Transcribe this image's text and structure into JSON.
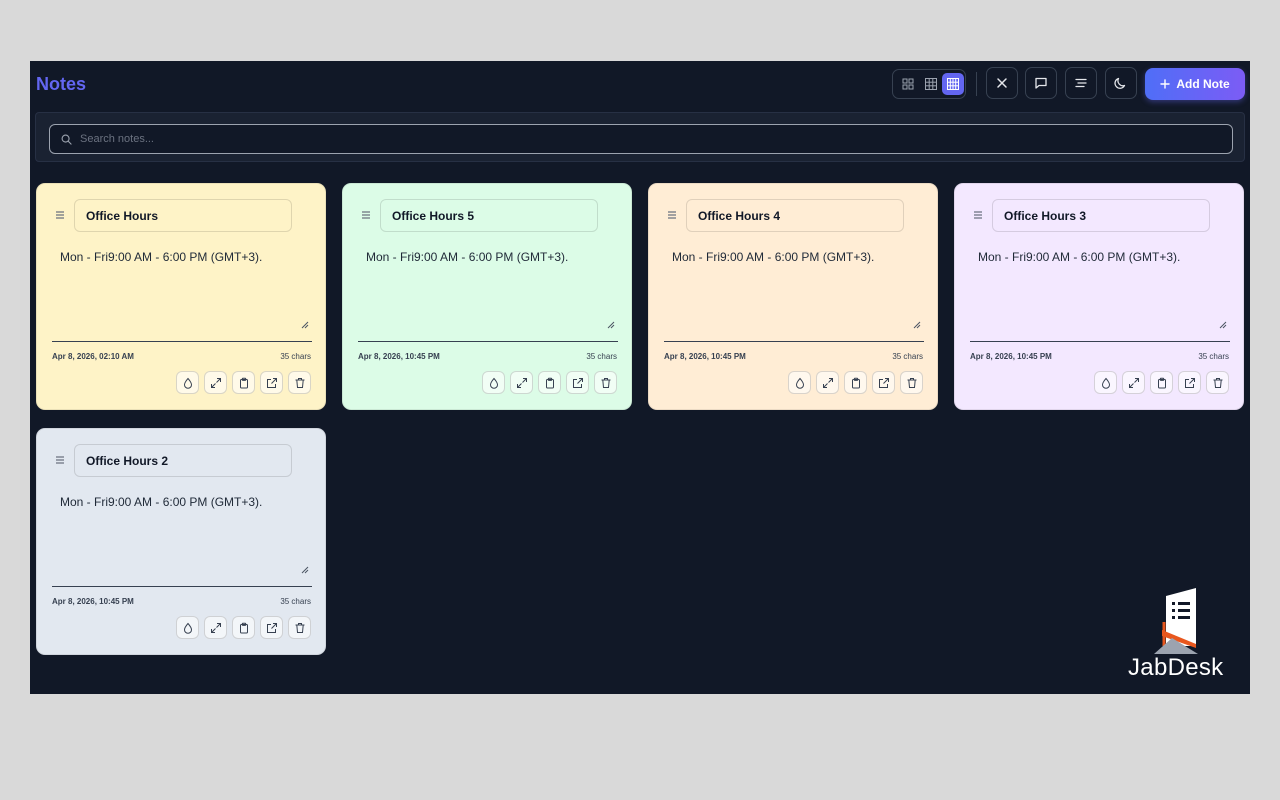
{
  "app": {
    "title": "Notes"
  },
  "toolbar": {
    "add_note_label": "Add Note",
    "view_modes": [
      "grid-2-icon",
      "grid-3-icon",
      "grid-4-icon"
    ],
    "active_view": "grid-4-icon"
  },
  "search": {
    "placeholder": "Search notes...",
    "value": ""
  },
  "notes": [
    {
      "title": "Office Hours",
      "body": "Mon - Fri9:00 AM - 6:00 PM (GMT+3).",
      "date": "Apr 8, 2026, 02:10 AM",
      "chars": "35 chars",
      "color": "#fef3c7"
    },
    {
      "title": "Office Hours 5",
      "body": "Mon - Fri9:00 AM - 6:00 PM (GMT+3).",
      "date": "Apr 8, 2026, 10:45 PM",
      "chars": "35 chars",
      "color": "#dcfce7"
    },
    {
      "title": "Office Hours 4",
      "body": "Mon - Fri9:00 AM - 6:00 PM (GMT+3).",
      "date": "Apr 8, 2026, 10:45 PM",
      "chars": "35 chars",
      "color": "#ffedd5"
    },
    {
      "title": "Office Hours 3",
      "body": "Mon - Fri9:00 AM - 6:00 PM (GMT+3).",
      "date": "Apr 8, 2026, 10:45 PM",
      "chars": "35 chars",
      "color": "#f3e8ff"
    },
    {
      "title": "Office Hours 2",
      "body": "Mon - Fri9:00 AM - 6:00 PM (GMT+3).",
      "date": "Apr 8, 2026, 10:45 PM",
      "chars": "35 chars",
      "color": "#e2e8f0"
    }
  ],
  "watermark": {
    "text": "JabDesk"
  },
  "colors": {
    "app_bg": "#111827",
    "accent": "#6366f1",
    "page_bg": "#d9d9d9"
  }
}
